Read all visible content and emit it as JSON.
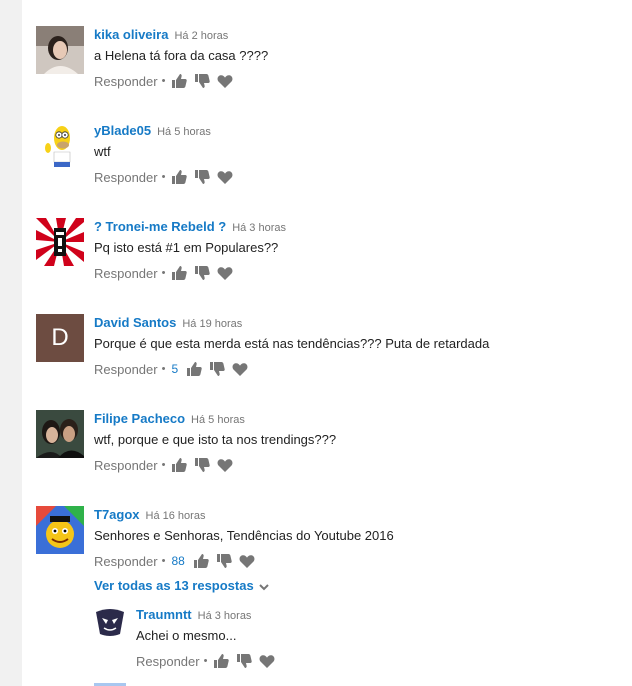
{
  "comments": [
    {
      "author": "kika oliveira",
      "time": "Há 2 horas",
      "text": "a Helena tá fora da casa ????",
      "reply": "Responder",
      "likes": "",
      "avatar": "photo-avatar"
    },
    {
      "author": "yBlade05",
      "time": "Há 5 horas",
      "text": "wtf",
      "reply": "Responder",
      "likes": "",
      "avatar": "cartoon-avatar"
    },
    {
      "author": "? Tronei-me Rebeld ?",
      "time": "Há 3 horas",
      "text": "Pq isto está #1 em Populares??",
      "reply": "Responder",
      "likes": "",
      "avatar": "flag-avatar"
    },
    {
      "author": "David Santos",
      "time": "Há 19 horas",
      "text": "Porque é que esta merda está nas tendências??? Puta de retardada",
      "reply": "Responder",
      "likes": "5",
      "avatar": "letter-avatar",
      "initial": "D"
    },
    {
      "author": "Filipe Pacheco",
      "time": "Há 5 horas",
      "text": "wtf, porque e que isto ta nos trendings???",
      "reply": "Responder",
      "likes": "",
      "avatar": "photo-avatar"
    },
    {
      "author": "T7agox",
      "time": "Há 16 horas",
      "text": "Senhores e Senhoras, Tendências do Youtube 2016",
      "reply": "Responder",
      "likes": "88",
      "avatar": "cartoon-avatar"
    }
  ],
  "view_replies": "Ver todas as 13 respostas",
  "reply": {
    "author": "Traumntt",
    "time": "Há 3 horas",
    "text": "Achei o mesmo...",
    "reply": "Responder",
    "likes": "",
    "avatar": "mask-avatar"
  },
  "colors": {
    "link": "#167ac6",
    "muted": "#767676",
    "icon": "#767676",
    "letter_avatar_bg": "#6d4c41"
  }
}
